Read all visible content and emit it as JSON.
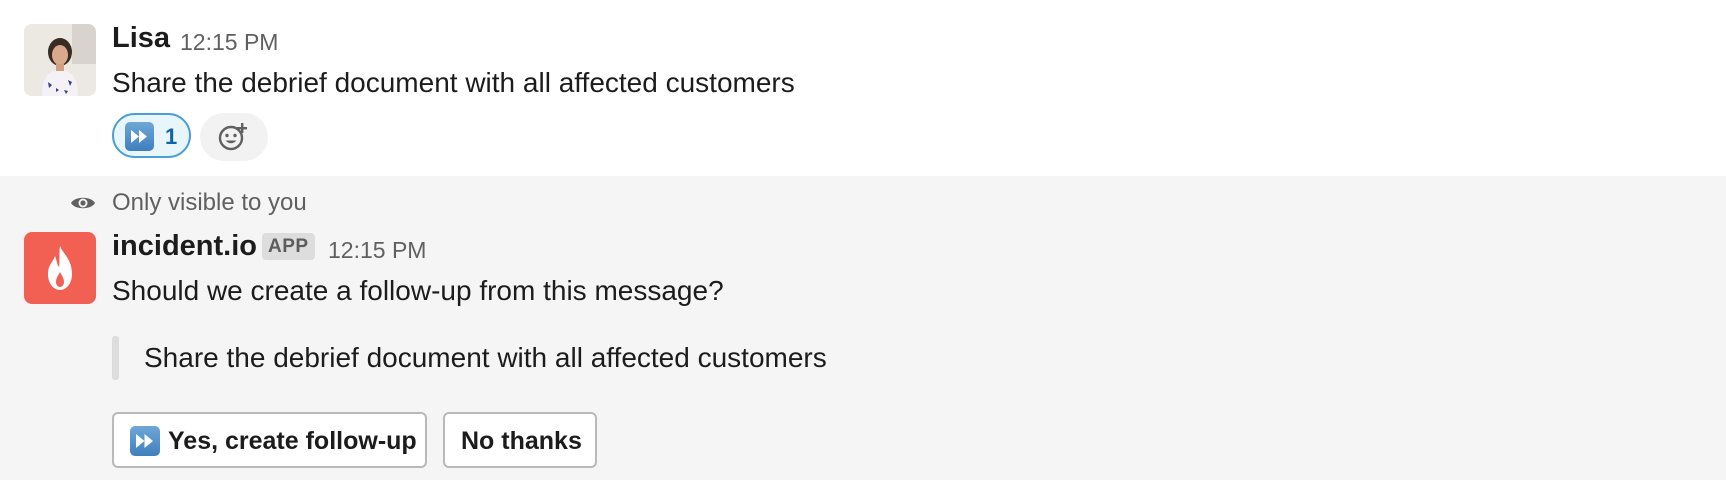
{
  "message1": {
    "author": "Lisa",
    "time": "12:15 PM",
    "text": "Share the debrief document with all affected customers",
    "reaction": {
      "icon": "fast-forward-emoji",
      "count": "1"
    },
    "add_reaction_icon": "add-emoji-icon"
  },
  "message2": {
    "visibility_note": "Only visible to you",
    "author": "incident.io",
    "badge": "APP",
    "time": "12:15 PM",
    "text": "Should we create a follow-up from this message?",
    "quote": "Share the debrief document with all affected customers",
    "buttons": {
      "yes_label": "Yes, create follow-up",
      "no_label": "No thanks"
    }
  },
  "colors": {
    "app_avatar": "#f25f53",
    "reaction_border": "#4a9fd8",
    "reaction_count": "#1264a3"
  }
}
